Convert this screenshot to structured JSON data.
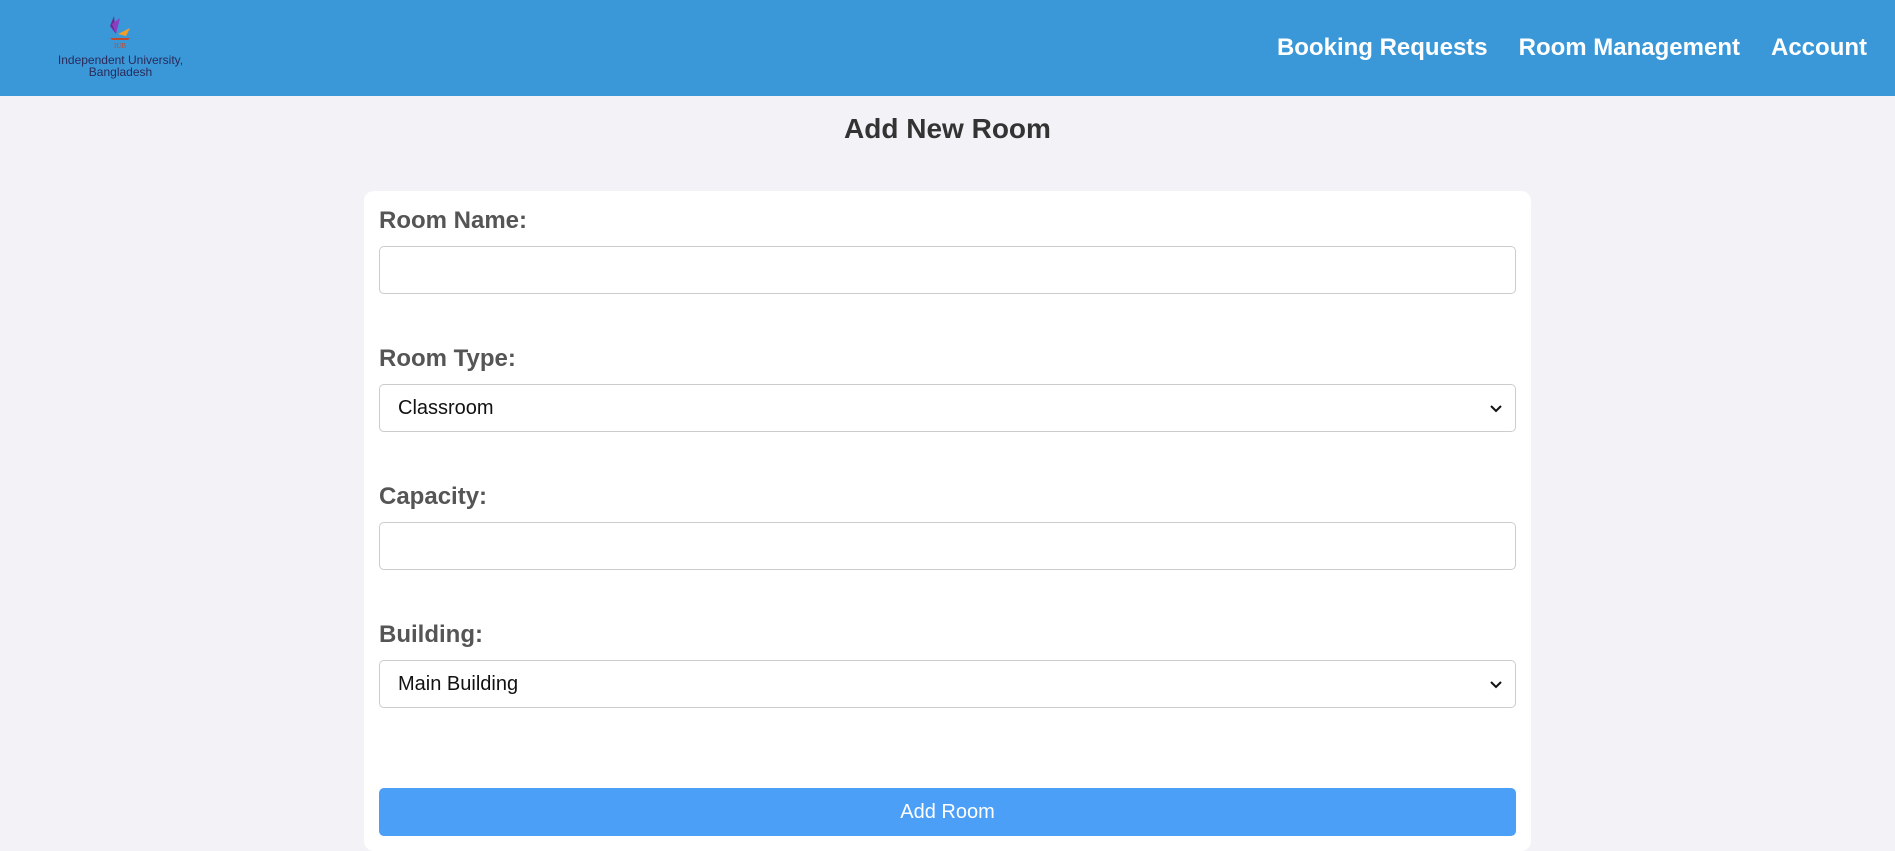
{
  "header": {
    "logo_line1": "Independent University,",
    "logo_line2": "Bangladesh",
    "nav": [
      {
        "label": "Booking Requests"
      },
      {
        "label": "Room Management"
      },
      {
        "label": "Account"
      }
    ],
    "accent_color": "#3a98d8"
  },
  "page": {
    "title": "Add New Room"
  },
  "form": {
    "room_name": {
      "label": "Room Name:",
      "value": ""
    },
    "room_type": {
      "label": "Room Type:",
      "selected": "Classroom"
    },
    "capacity": {
      "label": "Capacity:",
      "value": ""
    },
    "building": {
      "label": "Building:",
      "selected": "Main Building"
    },
    "submit_label": "Add Room",
    "submit_color": "#4c9ff7"
  },
  "icons": {
    "logo": "iub-logo-icon",
    "select_arrow": "chevron-down-icon"
  }
}
